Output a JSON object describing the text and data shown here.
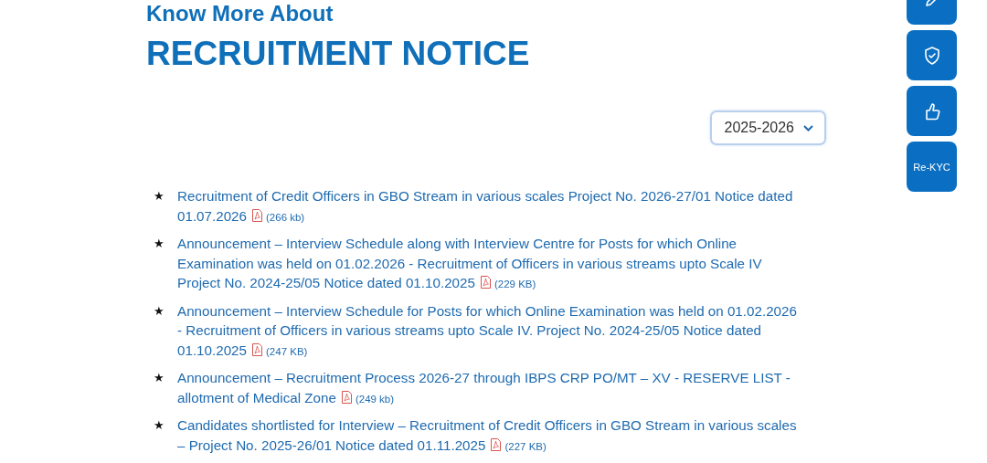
{
  "heading": {
    "kicker": "Know More About",
    "title": "RECRUITMENT NOTICE"
  },
  "year_select": {
    "value": "2025-2026"
  },
  "notices": [
    {
      "marker": "★",
      "text": "Recruitment of Credit Officers in GBO Stream in various scales Project No. 2026-27/01 Notice dated 01.07.2026",
      "size": "(266 kb)"
    },
    {
      "marker": "★",
      "text": "Announcement – Interview Schedule along with Interview Centre for Posts for which Online Examination was held on 01.02.2026 - Recruitment of Officers in various streams upto Scale IV Project No. 2024-25/05 Notice dated 01.10.2025",
      "size": "(229 KB)"
    },
    {
      "marker": "★",
      "text": "Announcement – Interview Schedule for Posts for which Online Examination was held on 01.02.2026 - Recruitment of Officers in various streams upto Scale IV. Project No. 2024-25/05 Notice dated 01.10.2025",
      "size": "(247 KB)"
    },
    {
      "marker": "★",
      "text": "Announcement – Recruitment Process 2026-27 through IBPS CRP PO/MT – XV - RESERVE LIST - allotment of Medical Zone",
      "size": "(249 kb)"
    },
    {
      "marker": "★",
      "text": "Candidates shortlisted for Interview – Recruitment of Credit Officers in GBO Stream in various scales – Project No. 2025-26/01 Notice dated 01.11.2025",
      "size": "(227 KB)"
    }
  ],
  "side_buttons": [
    {
      "kind": "pen"
    },
    {
      "kind": "shield"
    },
    {
      "kind": "thumb"
    },
    {
      "kind": "text",
      "label": "Re-KYC"
    }
  ]
}
